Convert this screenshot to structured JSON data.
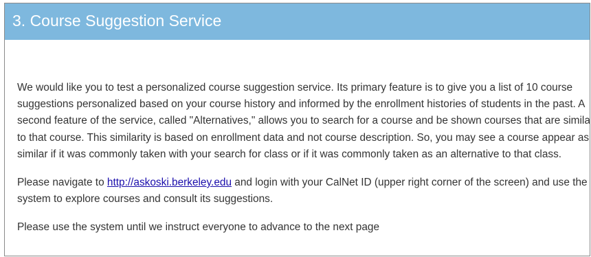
{
  "section": {
    "title": "3. Course Suggestion Service"
  },
  "intro": {
    "lines": [
      "We would like you to test a personalized course suggestion service. Its primary feature is to give you a list of 10 course",
      "suggestions personalized based on your course history and informed by the enrollment histories of students in the past. A",
      "second feature of the service, called \"Alternatives,\" allows you to search for a course and be shown courses that are similar",
      "to that course. This similarity is based on enrollment data and not course description. So, you may see a course appear as",
      "similar if it was commonly taken with your search for class or if it was commonly taken as an alternative to that class."
    ]
  },
  "navigate": {
    "before_link": "Please navigate to ",
    "link_text": "http://askoski.berkeley.edu",
    "after_link": " and login with your CalNet ID (upper right corner of the screen) and use the",
    "line2": "system to explore courses and consult its suggestions."
  },
  "instruction": {
    "text": "Please use the system until we instruct everyone to advance to the next page"
  },
  "colors": {
    "header_bg": "#7eb8de",
    "header_text": "#ffffff",
    "body_text": "#333333",
    "link": "#1a0dab"
  }
}
